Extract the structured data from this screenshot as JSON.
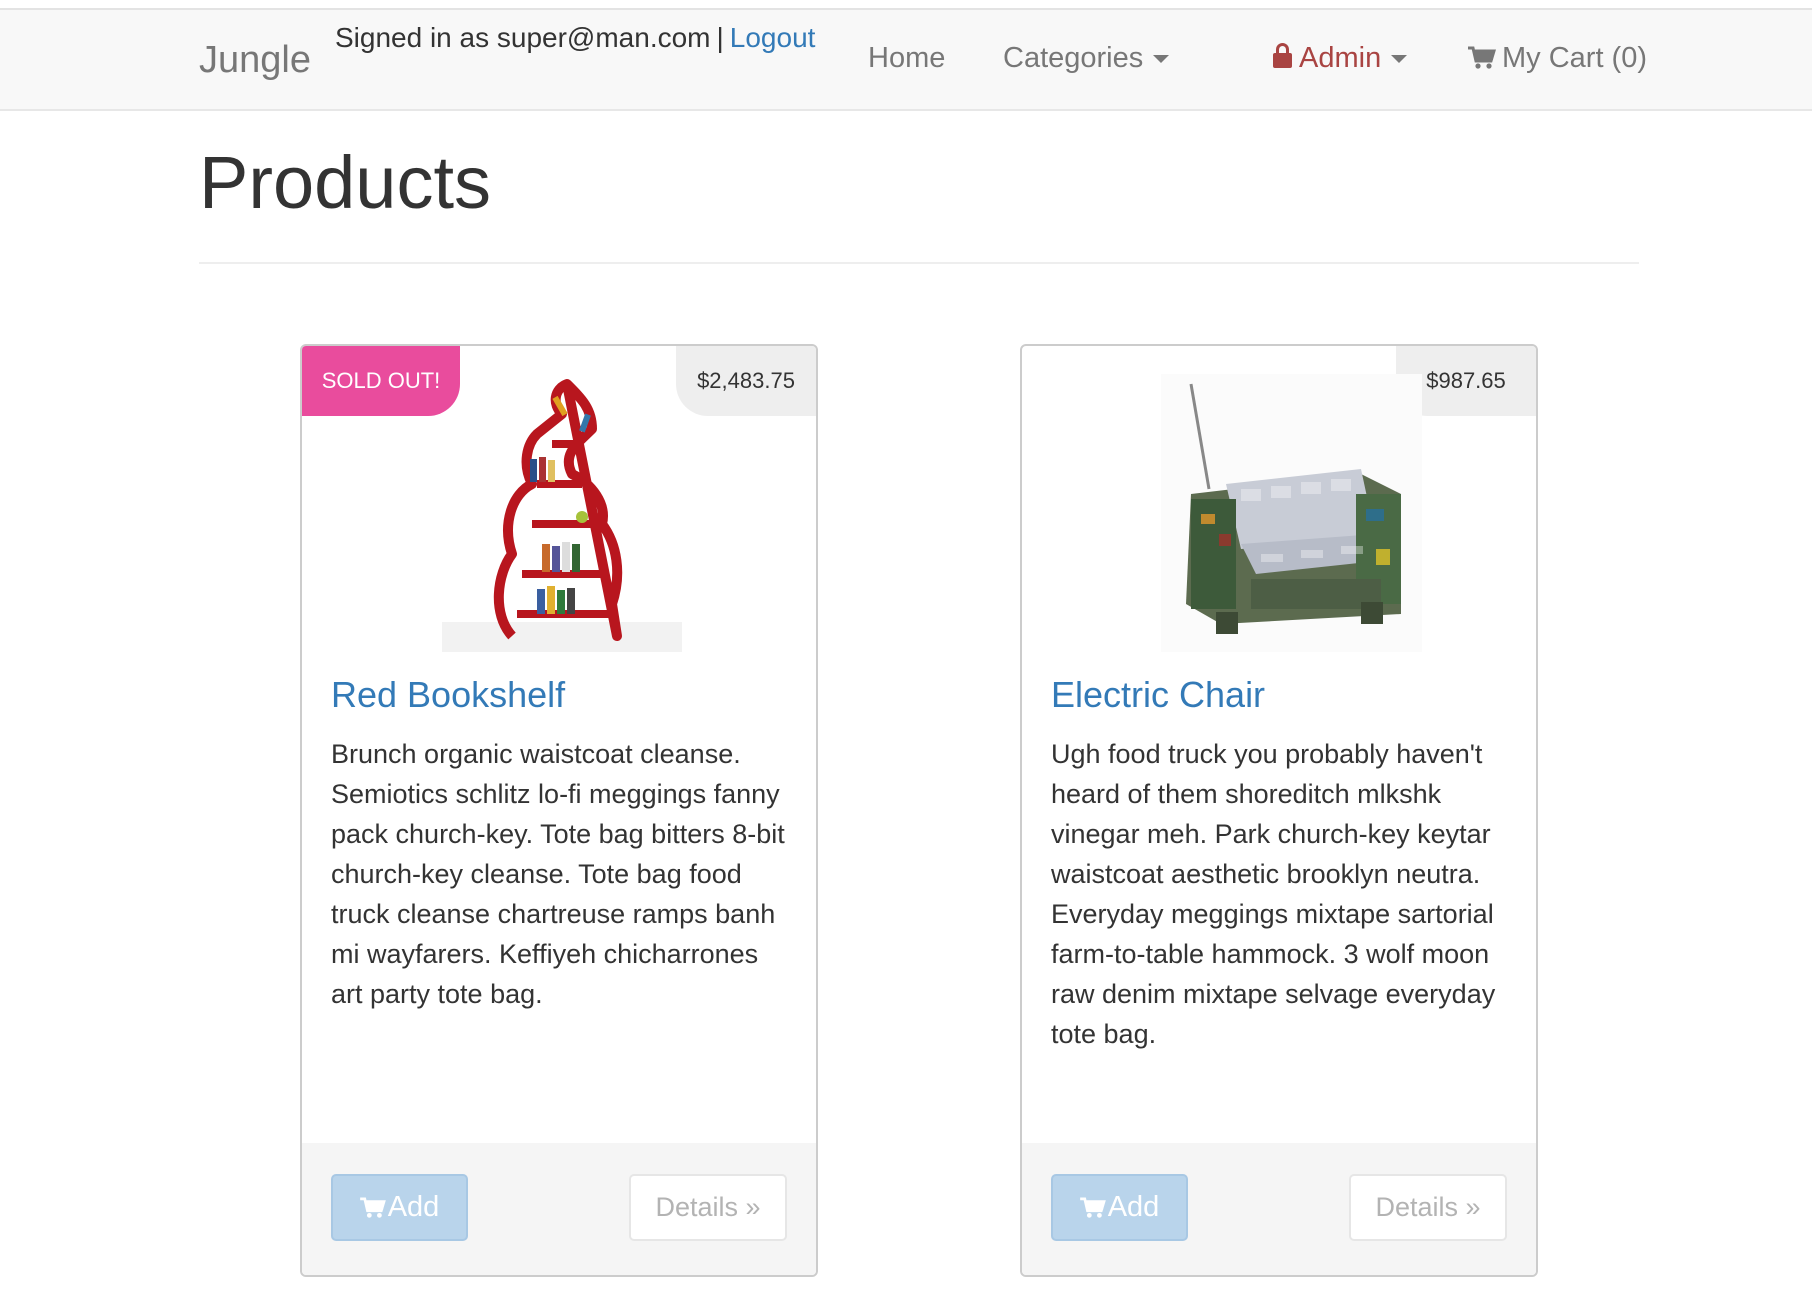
{
  "navbar": {
    "brand": "Jungle",
    "signed_in_text": "Signed in as super@man.com",
    "separator": "|",
    "logout_label": "Logout",
    "home_label": "Home",
    "categories_label": "Categories",
    "admin_label": "Admin",
    "cart_label": "My Cart (0)"
  },
  "page": {
    "title": "Products"
  },
  "products": [
    {
      "name": "Red Bookshelf",
      "price": "$2,483.75",
      "badge": "SOLD OUT!",
      "description": "Brunch organic waistcoat cleanse. Semiotics schlitz lo-fi meggings fanny pack church-key. Tote bag bitters 8-bit church-key cleanse. Tote bag food truck cleanse chartreuse ramps banh mi wayfarers. Keffiyeh chicharrones art party tote bag.",
      "add_label": "Add",
      "details_label": "Details »"
    },
    {
      "name": "Electric Chair",
      "price": "$987.65",
      "description": "Ugh food truck you probably haven't heard of them shoreditch mlkshk vinegar meh. Park church-key keytar waistcoat aesthetic brooklyn neutra. Everyday meggings mixtape sartorial farm-to-table hammock. 3 wolf moon raw denim mixtape selvage everyday tote bag.",
      "add_label": "Add",
      "details_label": "Details »"
    }
  ],
  "colors": {
    "link": "#337ab7",
    "admin": "#a94442",
    "sold_out": "#e94c9d",
    "add_button": "#b9d4eb"
  },
  "icons": {
    "admin": "lock-icon",
    "cart": "cart-icon",
    "dropdown": "caret-down-icon"
  }
}
